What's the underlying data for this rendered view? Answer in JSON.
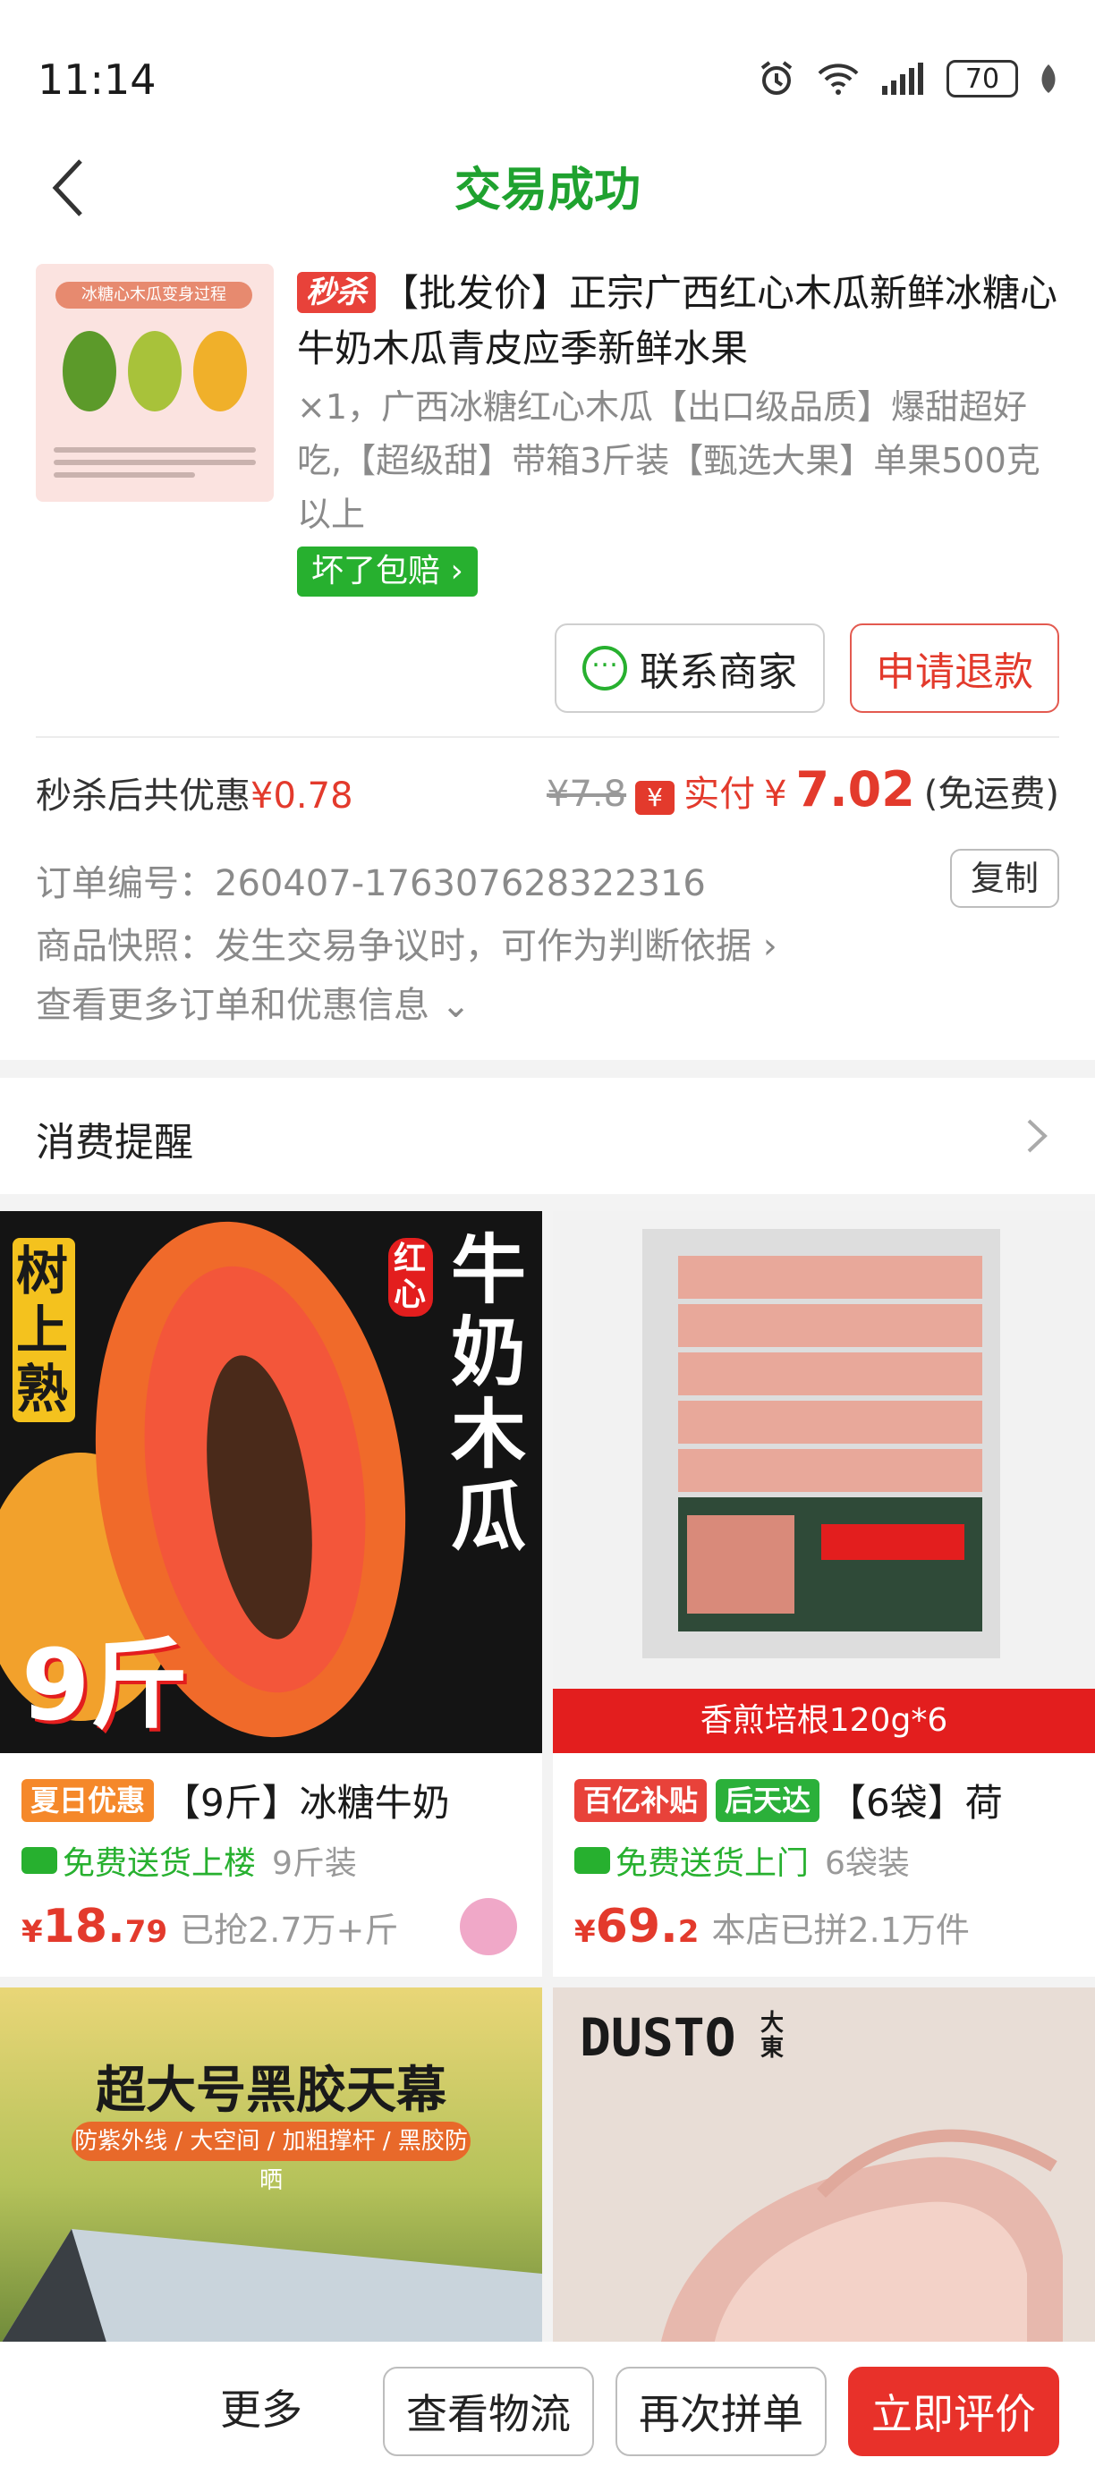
{
  "status_bar": {
    "time": "11:14",
    "battery": "70"
  },
  "nav": {
    "title": "交易成功"
  },
  "order": {
    "thumb_title": "冰糖心木瓜变身过程",
    "seckill_tag": "秒杀",
    "title": "【批发价】正宗广西红心木瓜新鲜冰糖心牛奶木瓜青皮应季新鲜水果",
    "spec": "×1，广西冰糖红心木瓜【出口级品质】爆甜超好吃,【超级甜】带箱3斤装【甄选大果】单果500克以上",
    "guarantee": "坏了包赔",
    "contact_button": "联系商家",
    "refund_button": "申请退款",
    "discount_label": "秒杀后共优惠",
    "discount_value": "¥0.78",
    "original_price": "¥7.8",
    "pay_icon": "¥",
    "pay_label": "实付",
    "pay_currency": "¥",
    "pay_value": "7.02",
    "pay_note": "(免运费)"
  },
  "order_info": {
    "order_number": "订单编号：260407-176307628322316",
    "copy_button": "复制",
    "snapshot": "商品快照：发生交易争议时，可作为判断依据",
    "more": "查看更多订单和优惠信息"
  },
  "reminder": {
    "label": "消费提醒"
  },
  "products": [
    {
      "image_text_left": "树上熟",
      "image_text_badge": "红心",
      "image_text_main": "牛奶木瓜",
      "image_text_weight": "9斤",
      "badge": "夏日优惠",
      "title": "【9斤】冰糖牛奶",
      "delivery": "免费送货上楼",
      "spec": "9斤装",
      "price_currency": "¥",
      "price_int": "18.",
      "price_dec": "79",
      "sold": "已抢2.7万+斤"
    },
    {
      "image_banner": "香煎培根120g*6",
      "badge1": "百亿补贴",
      "badge2": "后天达",
      "title": "【6袋】荷",
      "delivery": "免费送货上门",
      "spec": "6袋装",
      "price_currency": "¥",
      "price_int": "69.",
      "price_dec": "2",
      "sold": "本店已拼2.1万件"
    },
    {
      "image_title": "超大号黑胶天幕",
      "image_sub": "防紫外线 / 大空间 / 加粗撑杆 / 黑胶防晒"
    },
    {
      "image_brand": "DUSTO",
      "image_brand_sub": "大東"
    }
  ],
  "bottom_bar": {
    "more": "更多",
    "logistics": "查看物流",
    "regroup": "再次拼单",
    "review": "立即评价"
  },
  "colors": {
    "brand_green": "#1fa22f",
    "accent_red": "#e33a2c"
  }
}
